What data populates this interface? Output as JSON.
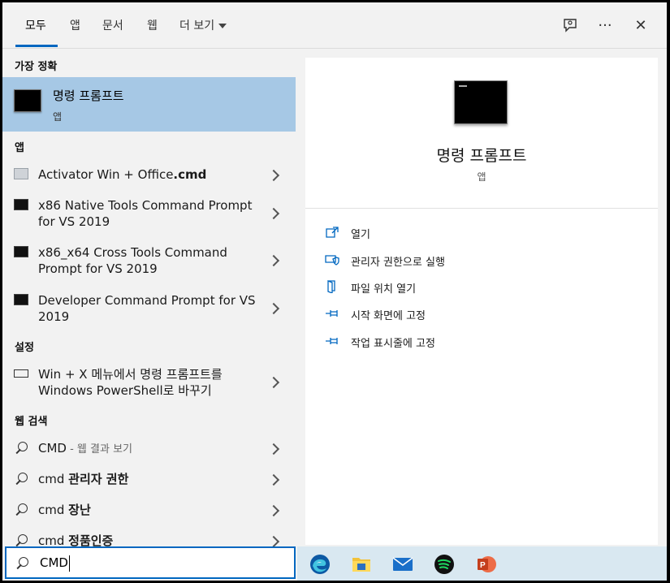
{
  "tabs": [
    "모두",
    "앱",
    "문서",
    "웹",
    "더 보기"
  ],
  "toolbar": {
    "feedback": "feedback-icon",
    "more": "···",
    "close": "✕"
  },
  "best_match": {
    "heading": "가장 정확",
    "title": "명령 프롬프트",
    "subtitle": "앱"
  },
  "apps": {
    "heading": "앱",
    "items": [
      {
        "pre": "Activator Win + Office",
        "bold": ".cmd"
      },
      {
        "pre": "x86 Native Tools Command Prompt for VS 2019",
        "bold": ""
      },
      {
        "pre": "x86_x64 Cross Tools Command Prompt for VS 2019",
        "bold": ""
      },
      {
        "pre": "Developer Command Prompt for VS 2019",
        "bold": ""
      }
    ]
  },
  "settings": {
    "heading": "설정",
    "items": [
      {
        "text": "Win + X 메뉴에서 명령 프롬프트를 Windows PowerShell로 바꾸기"
      }
    ]
  },
  "web": {
    "heading": "웹 검색",
    "items": [
      {
        "pre": "CMD",
        "suffix": " - 웹 결과 보기",
        "bold": ""
      },
      {
        "pre": "cmd ",
        "suffix": "",
        "bold": "관리자 권한"
      },
      {
        "pre": "cmd ",
        "suffix": "",
        "bold": "장난"
      },
      {
        "pre": "cmd ",
        "suffix": "",
        "bold": "정품인증"
      }
    ]
  },
  "preview": {
    "title": "명령 프롬프트",
    "subtitle": "앱",
    "actions": [
      "열기",
      "관리자 권한으로 실행",
      "파일 위치 열기",
      "시작 화면에 고정",
      "작업 표시줄에 고정"
    ]
  },
  "search": {
    "value": "CMD"
  },
  "taskbar_apps": [
    "edge-icon",
    "file-explorer-icon",
    "mail-icon",
    "spotify-icon",
    "powerpoint-icon"
  ],
  "colors": {
    "accent": "#0067c0",
    "selected": "#a6c8e5",
    "taskbar": "#d9e8f1"
  }
}
